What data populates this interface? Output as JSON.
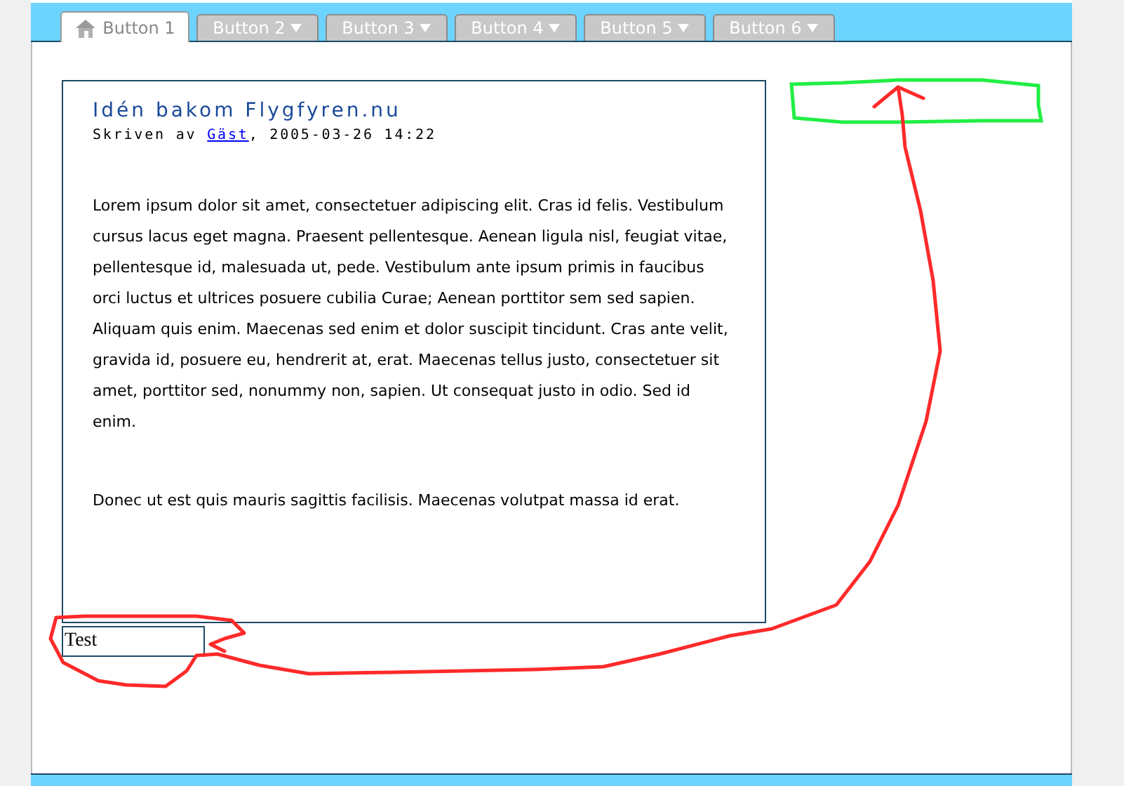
{
  "tabs": [
    {
      "label": "Button 1",
      "kind": "home",
      "selected": true
    },
    {
      "label": "Button 2",
      "kind": "menu",
      "selected": false
    },
    {
      "label": "Button 3",
      "kind": "menu",
      "selected": false
    },
    {
      "label": "Button 4",
      "kind": "menu",
      "selected": false
    },
    {
      "label": "Button 5",
      "kind": "menu",
      "selected": false
    },
    {
      "label": "Button 6",
      "kind": "menu",
      "selected": false
    }
  ],
  "article": {
    "title": "Idén bakom Flygfyren.nu",
    "byline_prefix": "Skriven av",
    "author": "Gäst",
    "byline_suffix": ", 2005-03-26 14:22",
    "paragraphs": [
      "Lorem ipsum dolor sit amet, consectetuer adipiscing elit. Cras id felis. Vestibulum cursus lacus eget magna. Praesent pellentesque. Aenean ligula nisl, feugiat vitae, pellentesque id, malesuada ut, pede. Vestibulum ante ipsum primis in faucibus orci luctus et ultrices posuere cubilia Curae; Aenean porttitor sem sed sapien. Aliquam quis enim. Maecenas sed enim et dolor suscipit tincidunt. Cras ante velit, gravida id, posuere eu, hendrerit at, erat. Maecenas tellus justo, consectetuer sit amet, porttitor sed, nonummy non, sapien. Ut consequat justo in odio. Sed id enim.",
      "Donec ut est quis mauris sagittis facilisis. Maecenas volutpat massa id erat."
    ]
  },
  "text_field": {
    "value": "Test"
  }
}
